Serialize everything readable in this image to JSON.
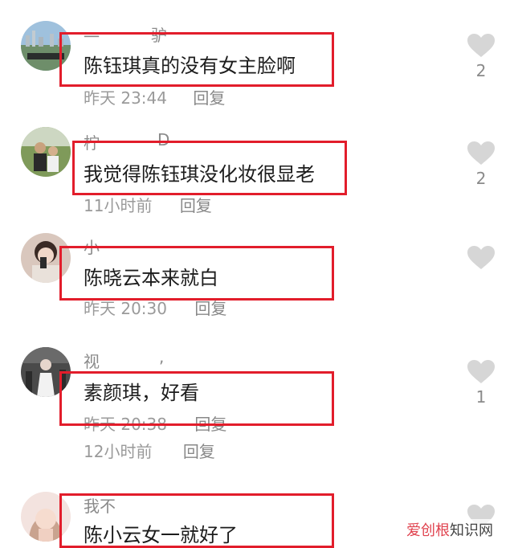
{
  "comments": [
    {
      "username": "一",
      "username_tail": "驴",
      "text": "陈钰琪真的没有女主脸啊",
      "time": "昨天 23:44",
      "reply": "回复",
      "likes": "2",
      "avatar_icon": "landscape-avatar"
    },
    {
      "username": "柠",
      "username_tail": "D",
      "text": "我觉得陈钰琪没化妆很显老",
      "time": "11小时前",
      "reply": "回复",
      "likes": "2",
      "avatar_icon": "photo-avatar"
    },
    {
      "username": "小",
      "username_tail": "",
      "text": "陈晓云本来就白",
      "time": "昨天 20:30",
      "reply": "回复",
      "likes": "",
      "avatar_icon": "portrait-avatar"
    },
    {
      "username": "视",
      "username_tail": ",",
      "text": "素颜琪，好看",
      "time": "昨天 20:38",
      "reply": "回复",
      "likes": "1",
      "avatar_icon": "dark-portrait-avatar"
    },
    {
      "username": "",
      "username_tail": "",
      "text": "",
      "time": "12小时前",
      "reply": "回复",
      "likes": "",
      "avatar_icon": ""
    },
    {
      "username": "我不",
      "username_tail": "",
      "text": "陈小云女一就好了",
      "time": "",
      "reply": "",
      "likes": "",
      "avatar_icon": "woman-portrait-avatar"
    }
  ],
  "watermark": {
    "red_part": "爱创根",
    "dark_part": "知识网"
  },
  "colors": {
    "highlight_box": "#e21d2b",
    "like_icon": "#d6d6d6"
  }
}
